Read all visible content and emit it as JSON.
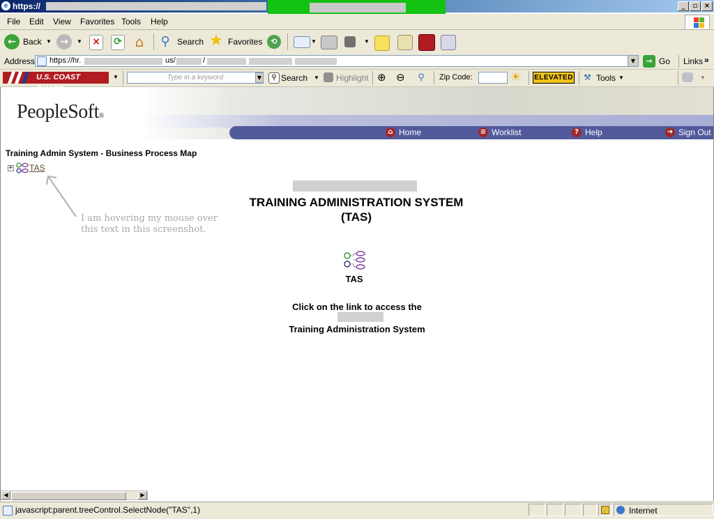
{
  "window": {
    "title": "https://",
    "url": "https://hr.",
    "url_mid": "us/",
    "url_sep": "/"
  },
  "menu": [
    "File",
    "Edit",
    "View",
    "Favorites",
    "Tools",
    "Help"
  ],
  "toolbar": {
    "back": "Back",
    "search": "Search",
    "favorites": "Favorites"
  },
  "address": {
    "label": "Address",
    "go": "Go",
    "links": "Links",
    "more": "»"
  },
  "cg_toolbar": {
    "brand": "U.S. COAST GUARD",
    "keyword_placeholder": "Type in a keyword",
    "search": "Search",
    "highlight": "Highlight",
    "zip_label": "Zip Code:",
    "elevated": "ELEVATED",
    "tools": "Tools"
  },
  "peoplesoft": {
    "logo": "PeopleSoft",
    "logo_mark": "®",
    "nav": [
      {
        "label": "Home",
        "icon": "home-icon"
      },
      {
        "label": "Worklist",
        "icon": "worklist-icon"
      },
      {
        "label": "Help",
        "icon": "help-icon"
      },
      {
        "label": "Sign Out",
        "icon": "sign-out-icon"
      }
    ]
  },
  "page": {
    "breadcrumb": "Training Admin System - Business Process Map",
    "tree_expand": "+",
    "tree_link": "TAS",
    "annotation": "I am hovering my mouse over this text in this screenshot.",
    "heading_line1": "TRAINING ADMINISTRATION SYSTEM",
    "heading_line2": "(TAS)",
    "icon_label": "TAS",
    "instruction_line1": "Click on the link to access the",
    "instruction_line2": "Training Administration System"
  },
  "status": {
    "text": "javascript:parent.treeControl.SelectNode(\"TAS\",1)",
    "zone": "Internet"
  },
  "colors": {
    "nav_bar": "#525a9c",
    "coast_guard_red": "#b01c22",
    "elevated_yellow": "#f2c418",
    "annotation_gray": "#a8a8a8"
  }
}
